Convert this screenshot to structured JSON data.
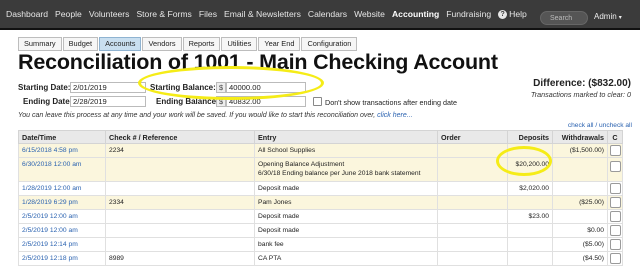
{
  "topnav": {
    "items": [
      {
        "label": "Dashboard"
      },
      {
        "label": "People"
      },
      {
        "label": "Volunteers"
      },
      {
        "label": "Store & Forms"
      },
      {
        "label": "Files"
      },
      {
        "label": "Email & Newsletters"
      },
      {
        "label": "Calendars"
      },
      {
        "label": "Website"
      },
      {
        "label": "Accounting"
      },
      {
        "label": "Fundraising"
      },
      {
        "label": "Help"
      }
    ],
    "search_placeholder": "Search",
    "admin_label": "Admin"
  },
  "subtabs": [
    {
      "label": "Summary"
    },
    {
      "label": "Budget"
    },
    {
      "label": "Accounts"
    },
    {
      "label": "Vendors"
    },
    {
      "label": "Reports"
    },
    {
      "label": "Utilities"
    },
    {
      "label": "Year End"
    },
    {
      "label": "Configuration"
    }
  ],
  "page": {
    "title": "Reconciliation of 1001 - Main Checking Account",
    "difference_label": "Difference: ($832.00)",
    "cleared_label": "Transactions marked to clear: 0"
  },
  "form": {
    "starting_date_label": "Starting Date:",
    "starting_date_value": "2/01/2019",
    "ending_date_label": "Ending Date:",
    "ending_date_value": "2/28/2019",
    "starting_balance_label": "Starting Balance:",
    "starting_balance_value": "40000.00",
    "ending_balance_label": "Ending Balance:",
    "ending_balance_value": "40832.00",
    "currency_prefix": "$",
    "dont_show_label": "Don't show transactions after ending date"
  },
  "note": {
    "text": "You can leave this process at any time and your work will be saved. If you would like to start this reconciliation over,",
    "link": "click here..."
  },
  "check_links": {
    "check_all": "check all",
    "separator": " / ",
    "uncheck_all": "uncheck all"
  },
  "table": {
    "headers": [
      "Date/Time",
      "Check # / Reference",
      "Entry",
      "Order",
      "Deposits",
      "Withdrawals",
      "C"
    ],
    "rows": [
      {
        "date": "6/15/2018 4:58 pm",
        "ref": "2234",
        "entry": "All School Supplies",
        "entry2": "",
        "order": "",
        "deposits": "",
        "withdrawals": "($1,500.00)"
      },
      {
        "date": "6/30/2018 12:00 am",
        "ref": "",
        "entry": "Opening Balance Adjustment",
        "entry2": "6/30/18 Ending balance per June 2018 bank statement",
        "order": "",
        "deposits": "$20,200.00",
        "withdrawals": ""
      },
      {
        "date": "1/28/2019 12:00 am",
        "ref": "",
        "entry": "Deposit made",
        "entry2": "",
        "order": "",
        "deposits": "$2,020.00",
        "withdrawals": ""
      },
      {
        "date": "1/28/2019 6:29 pm",
        "ref": "2334",
        "entry": "Pam Jones",
        "entry2": "",
        "order": "",
        "deposits": "",
        "withdrawals": "($25.00)"
      },
      {
        "date": "2/5/2019 12:00 am",
        "ref": "",
        "entry": "Deposit made",
        "entry2": "",
        "order": "",
        "deposits": "$23.00",
        "withdrawals": ""
      },
      {
        "date": "2/5/2019 12:00 am",
        "ref": "",
        "entry": "Deposit made",
        "entry2": "",
        "order": "",
        "deposits": "",
        "withdrawals": "$0.00"
      },
      {
        "date": "2/5/2019 12:14 pm",
        "ref": "",
        "entry": "bank fee",
        "entry2": "",
        "order": "",
        "deposits": "",
        "withdrawals": "($5.00)"
      },
      {
        "date": "2/5/2019 12:18 pm",
        "ref": "8989",
        "entry": "CA PTA",
        "entry2": "",
        "order": "",
        "deposits": "",
        "withdrawals": "($4.50)"
      }
    ]
  },
  "colors": {
    "nav_bg": "#3b3b3b",
    "link": "#2a62b0",
    "row_highlight": "#fbf6dd",
    "annotation": "#f5ec17"
  }
}
